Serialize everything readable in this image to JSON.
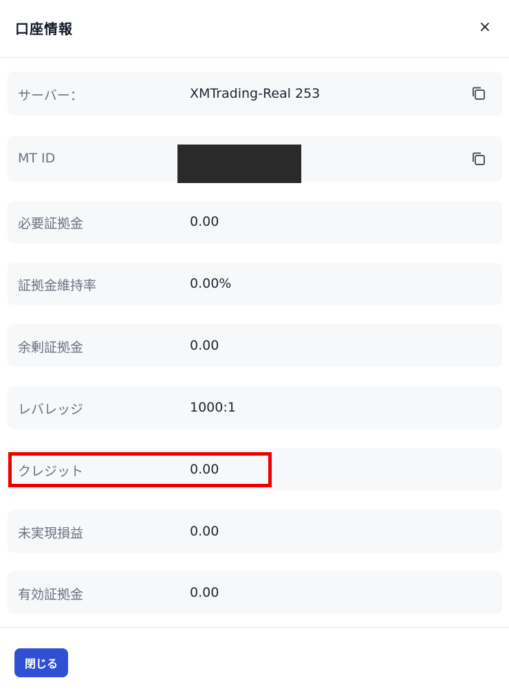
{
  "modal": {
    "title": "口座情報",
    "close_icon": "×",
    "close_button_label": "閉じる"
  },
  "rows": [
    {
      "label": "サーバー：",
      "value": "XMTrading-Real 253",
      "copyable": true
    },
    {
      "label": "MT ID",
      "value": "",
      "redacted": true,
      "copyable": true
    },
    {
      "label": "必要証拠金",
      "value": "0.00"
    },
    {
      "label": "証拠金維持率",
      "value": "0.00%"
    },
    {
      "label": "余剰証拠金",
      "value": "0.00"
    },
    {
      "label": "レバレッジ",
      "value": "1000:1"
    },
    {
      "label": "クレジット",
      "value": "0.00",
      "highlighted": true
    },
    {
      "label": "未実現損益",
      "value": "0.00"
    },
    {
      "label": "有効証拠金",
      "value": "0.00"
    }
  ],
  "icons": {
    "copy": "copy-icon",
    "close": "close-icon"
  },
  "colors": {
    "primary_button": "#2f50d4",
    "highlight": "#ee0000",
    "row_background": "#f6f8fa"
  }
}
